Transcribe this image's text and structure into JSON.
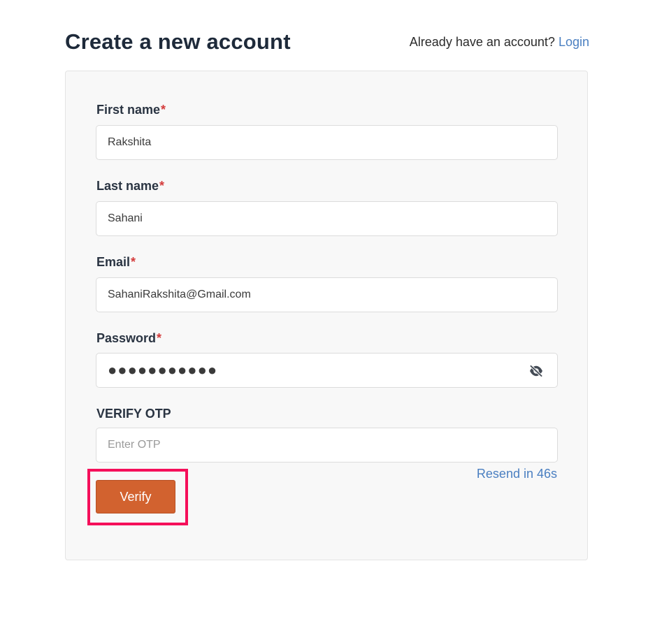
{
  "header": {
    "title": "Create a new account",
    "login_prompt": "Already have an account?",
    "login_link": "Login"
  },
  "form": {
    "first_name": {
      "label": "First name",
      "required_mark": "*",
      "value": "Rakshita"
    },
    "last_name": {
      "label": "Last name",
      "required_mark": "*",
      "value": "Sahani"
    },
    "email": {
      "label": "Email",
      "required_mark": "*",
      "value": "SahaniRakshita@Gmail.com"
    },
    "password": {
      "label": "Password",
      "required_mark": "*",
      "masked_value": "●●●●●●●●●●●",
      "toggle_icon": "eye-slash-icon"
    },
    "otp": {
      "label": "VERIFY OTP",
      "placeholder": "Enter OTP",
      "value": ""
    },
    "resend_text": "Resend in 46s",
    "verify_label": "Verify"
  },
  "colors": {
    "title": "#1e2a3a",
    "link": "#4a7fc1",
    "required": "#d43c3c",
    "verify_button": "#d2622f",
    "highlight_box": "#f50f5a",
    "card_background": "#f8f8f8"
  }
}
